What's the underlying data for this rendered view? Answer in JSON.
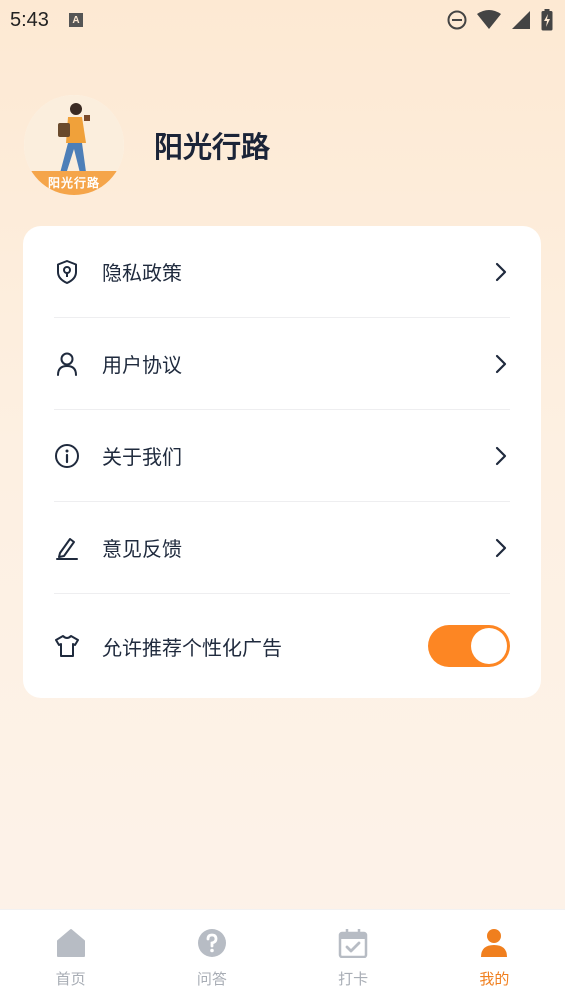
{
  "status_bar": {
    "time": "5:43",
    "notification_badge": "A"
  },
  "profile": {
    "name": "阳光行路",
    "avatar_banner": "阳光行路"
  },
  "menu": {
    "items": [
      {
        "label": "隐私政策",
        "icon": "shield-icon"
      },
      {
        "label": "用户协议",
        "icon": "user-icon"
      },
      {
        "label": "关于我们",
        "icon": "info-icon"
      },
      {
        "label": "意见反馈",
        "icon": "edit-icon"
      }
    ],
    "toggle_item": {
      "label": "允许推荐个性化广告",
      "icon": "shirt-icon",
      "enabled": true
    }
  },
  "tab_bar": {
    "tabs": [
      {
        "label": "首页",
        "icon": "home-icon",
        "active": false
      },
      {
        "label": "问答",
        "icon": "question-icon",
        "active": false
      },
      {
        "label": "打卡",
        "icon": "calendar-check-icon",
        "active": false
      },
      {
        "label": "我的",
        "icon": "person-icon",
        "active": true
      }
    ]
  },
  "colors": {
    "accent": "#fd8623",
    "tab_active": "#f07f1e",
    "tab_inactive": "#a8adb5",
    "background_top": "#fde9d3",
    "text_primary": "#1f2a3d"
  }
}
